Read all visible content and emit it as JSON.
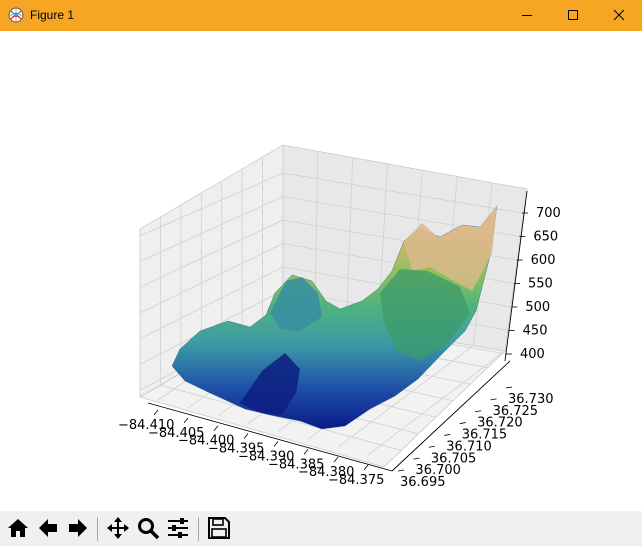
{
  "window": {
    "title": "Figure 1",
    "accent_color": "#f6a623",
    "controls": [
      "minimize-icon",
      "maximize-icon",
      "close-icon"
    ]
  },
  "toolbar": {
    "buttons": [
      {
        "name": "home-button",
        "icon": "home-icon",
        "tooltip": "Home"
      },
      {
        "name": "back-button",
        "icon": "arrow-left-icon",
        "tooltip": "Back"
      },
      {
        "name": "forward-button",
        "icon": "arrow-right-icon",
        "tooltip": "Forward"
      },
      {
        "name": "pan-button",
        "icon": "move-icon",
        "tooltip": "Pan"
      },
      {
        "name": "zoom-button",
        "icon": "magnifier-icon",
        "tooltip": "Zoom"
      },
      {
        "name": "configure-button",
        "icon": "sliders-icon",
        "tooltip": "Configure subplots"
      },
      {
        "name": "save-button",
        "icon": "floppy-disk-icon",
        "tooltip": "Save"
      }
    ]
  },
  "chart_data": {
    "type": "surface",
    "title": "",
    "xlabel": "",
    "ylabel": "",
    "zlabel": "",
    "x_ticks": [
      "−84.410",
      "−84.405",
      "−84.400",
      "−84.395",
      "−84.390",
      "−84.385",
      "−84.380",
      "−84.375"
    ],
    "y_ticks": [
      "36.695",
      "36.700",
      "36.705",
      "36.710",
      "36.715",
      "36.720",
      "36.725",
      "36.730"
    ],
    "z_ticks": [
      "400",
      "450",
      "500",
      "550",
      "600",
      "650",
      "700"
    ],
    "x_range": [
      -84.41,
      -84.375
    ],
    "y_range": [
      36.695,
      36.73
    ],
    "z_range": [
      385,
      720
    ],
    "colormap": "gist_earth",
    "grid": true
  }
}
